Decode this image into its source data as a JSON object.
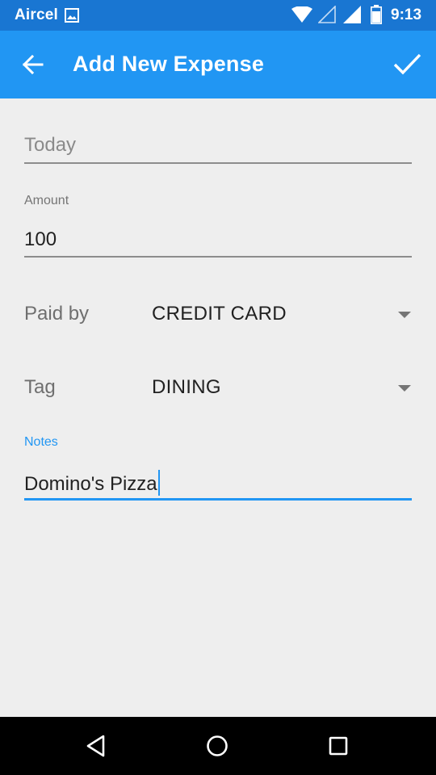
{
  "status_bar": {
    "carrier": "Aircel",
    "time": "9:13",
    "icons": [
      "gallery-icon",
      "wifi-icon",
      "signal-empty-icon",
      "signal-full-icon",
      "battery-icon"
    ]
  },
  "app_bar": {
    "title": "Add New Expense",
    "back_icon": "arrow-left-icon",
    "confirm_icon": "check-icon",
    "color": "#2196f3",
    "status_color": "#1976d2"
  },
  "form": {
    "date": {
      "placeholder": "Today"
    },
    "amount": {
      "label": "Amount",
      "value": "100"
    },
    "paid_by": {
      "label": "Paid by",
      "value": "CREDIT CARD"
    },
    "tag": {
      "label": "Tag",
      "value": "DINING"
    },
    "notes": {
      "label": "Notes",
      "value": "Domino's Pizza",
      "focused": true
    }
  },
  "nav_bar": {
    "icons": [
      "nav-back-icon",
      "nav-home-icon",
      "nav-recents-icon"
    ]
  },
  "colors": {
    "accent": "#2196f3",
    "background": "#eeeeee"
  }
}
